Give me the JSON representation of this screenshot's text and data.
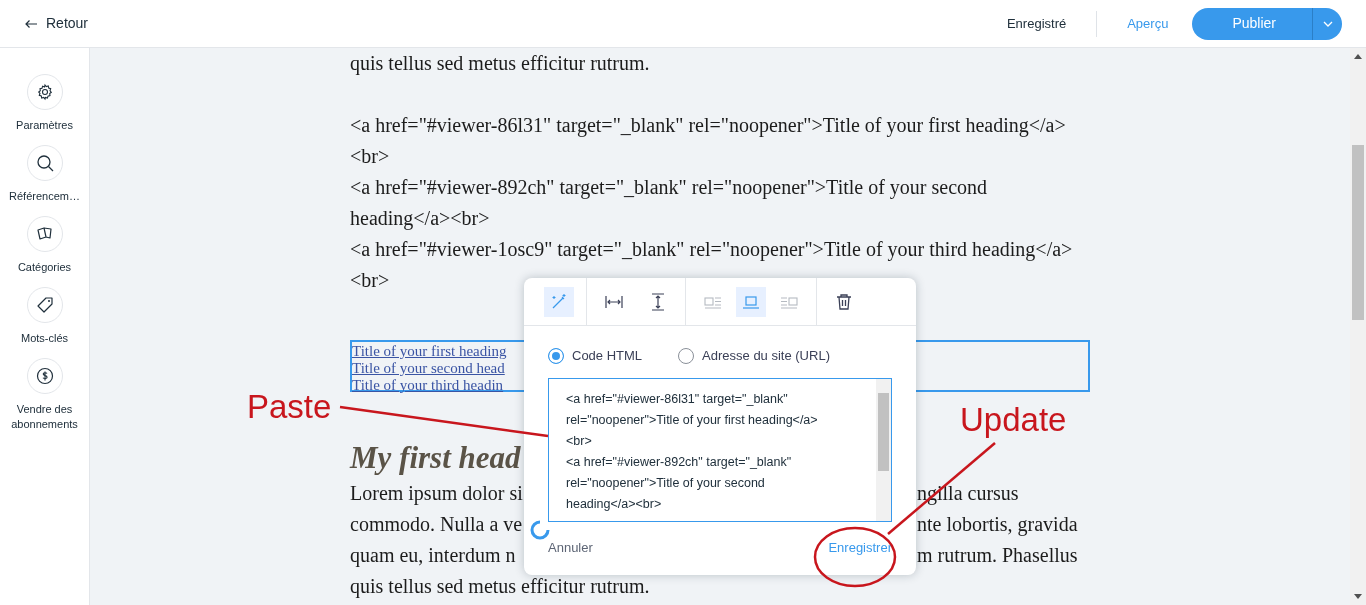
{
  "header": {
    "back": "Retour",
    "status": "Enregistré",
    "preview": "Aperçu",
    "publish": "Publier"
  },
  "sidebar": {
    "items": [
      {
        "kind": "gear",
        "label": "Paramètres"
      },
      {
        "kind": "search",
        "label": "Référencem…"
      },
      {
        "kind": "cards",
        "label": "Catégories"
      },
      {
        "kind": "tag",
        "label": "Mots-clés"
      },
      {
        "kind": "dollar",
        "label": "Vendre des abonnements"
      }
    ]
  },
  "document": {
    "blocks": [
      {
        "lines": [
          "quis tellus sed metus efficitur rutrum."
        ]
      },
      {
        "lines": [
          "<a href=\"#viewer-86l31\" target=\"_blank\" rel=\"noopener\">Title of your first heading</a>",
          "<br>",
          "<a href=\"#viewer-892ch\" target=\"_blank\" rel=\"noopener\">Title of your second",
          "heading</a><br>",
          "<a href=\"#viewer-1osc9\" target=\"_blank\" rel=\"noopener\">Title of your third heading</a>",
          "<br>"
        ]
      }
    ],
    "selected_links": [
      "Title of your first heading",
      "Title of your second head",
      "Title of your third headin"
    ],
    "heading": "My first head",
    "paragraph_lines": [
      {
        "left": "Lorem ipsum dolor si",
        "right": "ngilla cursus"
      },
      {
        "left": "commodo. Nulla a ve",
        "right": "nte lobortis, gravida"
      },
      {
        "left": "quam eu, interdum n",
        "right": "m rutrum. Phasellus"
      },
      {
        "left": "quis tellus sed metus efficitur rutrum."
      }
    ]
  },
  "popup": {
    "toolbar_groups": [
      {
        "tools": [
          {
            "kind": "wand",
            "selected": true
          }
        ]
      },
      {
        "tools": [
          {
            "kind": "width",
            "selected": false
          },
          {
            "kind": "height",
            "selected": false
          }
        ]
      },
      {
        "tools": [
          {
            "kind": "align-left",
            "selected": false
          },
          {
            "kind": "align-center",
            "selected": true
          },
          {
            "kind": "align-right",
            "selected": false
          }
        ]
      },
      {
        "tools": [
          {
            "kind": "trash",
            "selected": false
          }
        ]
      }
    ],
    "options": [
      {
        "label": "Code HTML",
        "selected": true
      },
      {
        "label": "Adresse du site (URL)",
        "selected": false
      }
    ],
    "code_lines": [
      "<a href=\"#viewer-86l31\" target=\"_blank\"",
      "rel=\"noopener\">Title of your first heading</a>",
      "<br>",
      "<a href=\"#viewer-892ch\" target=\"_blank\"",
      "rel=\"noopener\">Title of your second",
      "heading</a><br>"
    ],
    "cancel": "Annuler",
    "save": "Enregistrer"
  },
  "annotations": [
    {
      "kind": "paste",
      "text": "Paste"
    },
    {
      "kind": "update",
      "text": "Update"
    }
  ]
}
